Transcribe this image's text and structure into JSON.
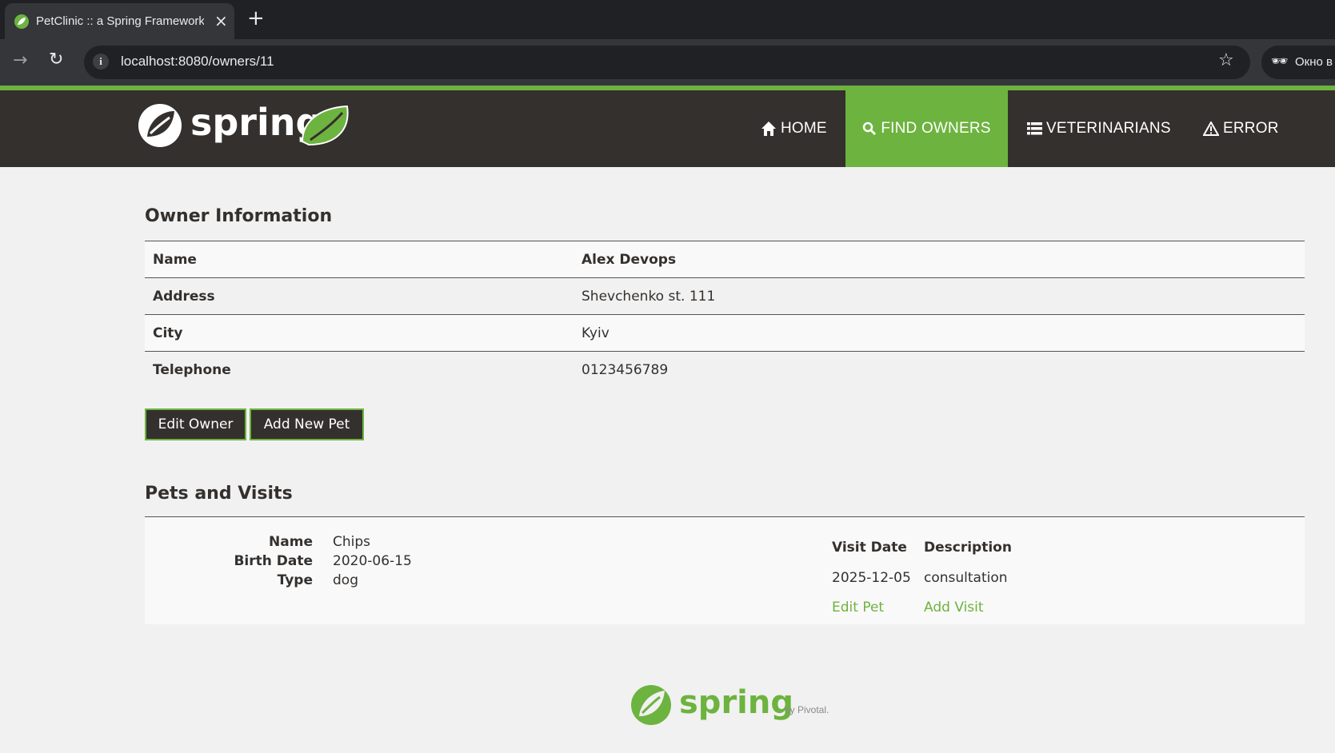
{
  "browser": {
    "tab_title": "PetClinic :: a Spring Framework",
    "url": "localhost:8080/owners/11",
    "incognito_label": "Окно в"
  },
  "navbar": {
    "brand": "spring",
    "items": [
      {
        "label": "HOME",
        "icon": "home-icon"
      },
      {
        "label": "FIND OWNERS",
        "icon": "search-icon",
        "active": true
      },
      {
        "label": "VETERINARIANS",
        "icon": "list-icon"
      },
      {
        "label": "ERROR",
        "icon": "warning-icon"
      }
    ]
  },
  "owner": {
    "section_title": "Owner Information",
    "rows": [
      {
        "label": "Name",
        "value": "Alex Devops"
      },
      {
        "label": "Address",
        "value": "Shevchenko st. 111"
      },
      {
        "label": "City",
        "value": "Kyiv"
      },
      {
        "label": "Telephone",
        "value": "0123456789"
      }
    ],
    "edit_button": "Edit Owner",
    "add_pet_button": "Add New Pet"
  },
  "pets": {
    "section_title": "Pets and Visits",
    "pet": {
      "name_label": "Name",
      "name": "Chips",
      "birth_label": "Birth Date",
      "birth_date": "2020-06-15",
      "type_label": "Type",
      "type": "dog"
    },
    "visits": {
      "date_header": "Visit Date",
      "description_header": "Description",
      "rows": [
        {
          "date": "2025-12-05",
          "description": "consultation"
        }
      ],
      "edit_pet_link": "Edit Pet",
      "add_visit_link": "Add Visit"
    }
  },
  "footer": {
    "brand": "spring",
    "byline": "by Pivotal."
  },
  "colors": {
    "brand_green": "#6db33f",
    "navbar_dark": "#34302d",
    "page_bg": "#f1f1f1"
  }
}
